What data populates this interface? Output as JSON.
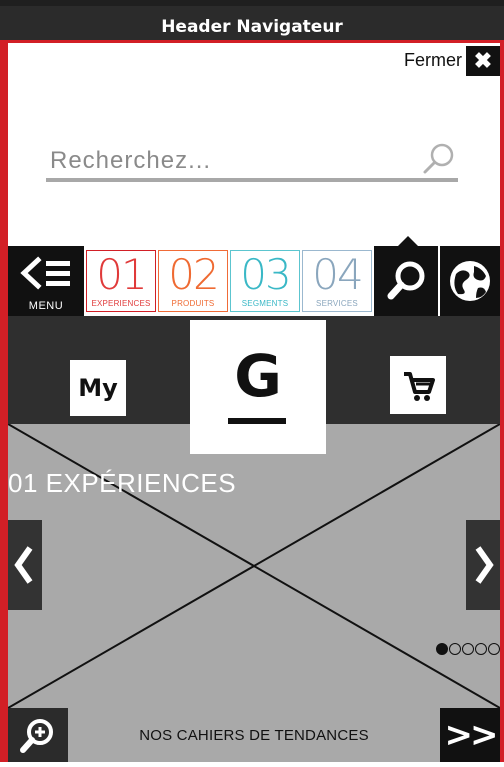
{
  "header": {
    "title": "Header Navigateur"
  },
  "close": {
    "label": "Fermer",
    "icon": "✖"
  },
  "search": {
    "placeholder": "Recherchez..."
  },
  "nav": {
    "menu_label": "MENU",
    "tiles": [
      {
        "num": "01",
        "caption": "EXPERIENCES",
        "color": "#e03a3a"
      },
      {
        "num": "02",
        "caption": "PRODUITS",
        "color": "#ef6a32"
      },
      {
        "num": "03",
        "caption": "SEGMENTS",
        "color": "#3ab8c6"
      },
      {
        "num": "04",
        "caption": "SERVICES",
        "color": "#8aa6bd"
      }
    ]
  },
  "logo": {
    "my_label": "My",
    "brand_letter": "G"
  },
  "slider": {
    "title": "01 EXPÉRIENCES",
    "prev_icon": "‹",
    "next_icon": "›",
    "dots_total": 5,
    "dots_active": 1
  },
  "bottom": {
    "trends_label": "NOS CAHIERS DE TENDANCES",
    "next_label": ">>"
  }
}
